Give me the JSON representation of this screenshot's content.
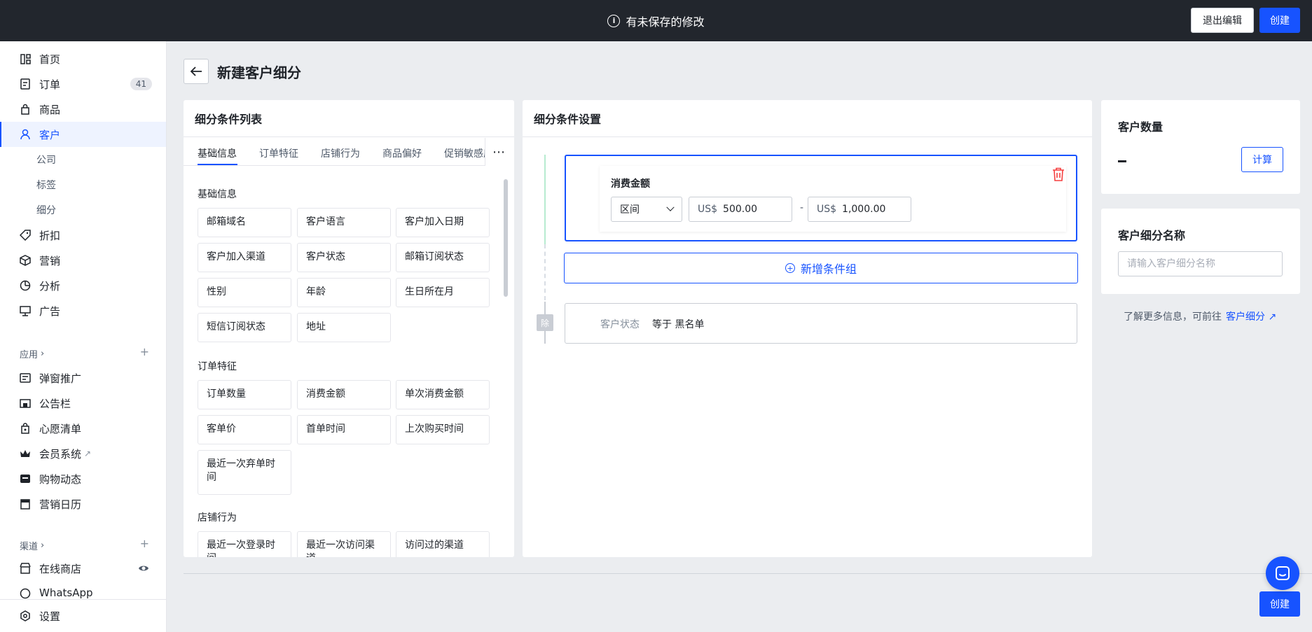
{
  "topbar": {
    "notice": "有未保存的修改",
    "exit_label": "退出编辑",
    "create_label": "创建"
  },
  "sidebar": {
    "items": [
      {
        "label": "首页",
        "icon": "home-icon"
      },
      {
        "label": "订单",
        "icon": "order-icon",
        "badge": "41"
      },
      {
        "label": "商品",
        "icon": "bag-icon"
      },
      {
        "label": "客户",
        "icon": "user-icon",
        "active": true
      },
      {
        "label": "公司"
      },
      {
        "label": "标签"
      },
      {
        "label": "细分"
      },
      {
        "label": "折扣",
        "icon": "tag-icon"
      },
      {
        "label": "营销",
        "icon": "box-icon"
      },
      {
        "label": "分析",
        "icon": "pie-icon"
      },
      {
        "label": "广告",
        "icon": "ad-icon"
      }
    ],
    "apps_label": "应用",
    "apps": [
      {
        "label": "弹窗推广"
      },
      {
        "label": "公告栏"
      },
      {
        "label": "心愿清单"
      },
      {
        "label": "会员系统"
      },
      {
        "label": "购物动态"
      },
      {
        "label": "营销日历"
      }
    ],
    "channels_label": "渠道",
    "channels": [
      {
        "label": "在线商店"
      },
      {
        "label": "WhatsApp"
      }
    ],
    "settings_label": "设置"
  },
  "page": {
    "title": "新建客户细分"
  },
  "conditions_list": {
    "title": "细分条件列表",
    "tabs": [
      "基础信息",
      "订单特征",
      "店铺行为",
      "商品偏好",
      "促销敏感度"
    ],
    "groups": [
      {
        "title": "基础信息",
        "chips": [
          "邮箱域名",
          "客户语言",
          "客户加入日期",
          "客户加入渠道",
          "客户状态",
          "邮箱订阅状态",
          "性别",
          "年龄",
          "生日所在月",
          "短信订阅状态",
          "地址"
        ]
      },
      {
        "title": "订单特征",
        "chips": [
          "订单数量",
          "消费金额",
          "单次消费金额",
          "客单价",
          "首单时间",
          "上次购买时间",
          "最近一次弃单时间"
        ]
      },
      {
        "title": "店铺行为",
        "chips": [
          "最近一次登录时间",
          "最近一次访问渠道",
          "访问过的渠道"
        ]
      }
    ]
  },
  "settings": {
    "title": "细分条件设置",
    "condition": {
      "title": "消费金额",
      "operator": "区间",
      "currency": "US$",
      "min": "500.00",
      "sep": "-",
      "max": "1,000.00"
    },
    "add_group_label": "新增条件组",
    "exclude_tag": "除",
    "exclude_key": "客户状态",
    "exclude_value": "等于 黑名单"
  },
  "customer_count": {
    "title": "客户数量",
    "calc_label": "计算"
  },
  "segment_name": {
    "title": "客户细分名称",
    "placeholder": "请输入客户细分名称"
  },
  "learn_more": {
    "text": "了解更多信息，可前往",
    "link": "客户细分"
  },
  "bottom": {
    "create_label": "创建"
  }
}
